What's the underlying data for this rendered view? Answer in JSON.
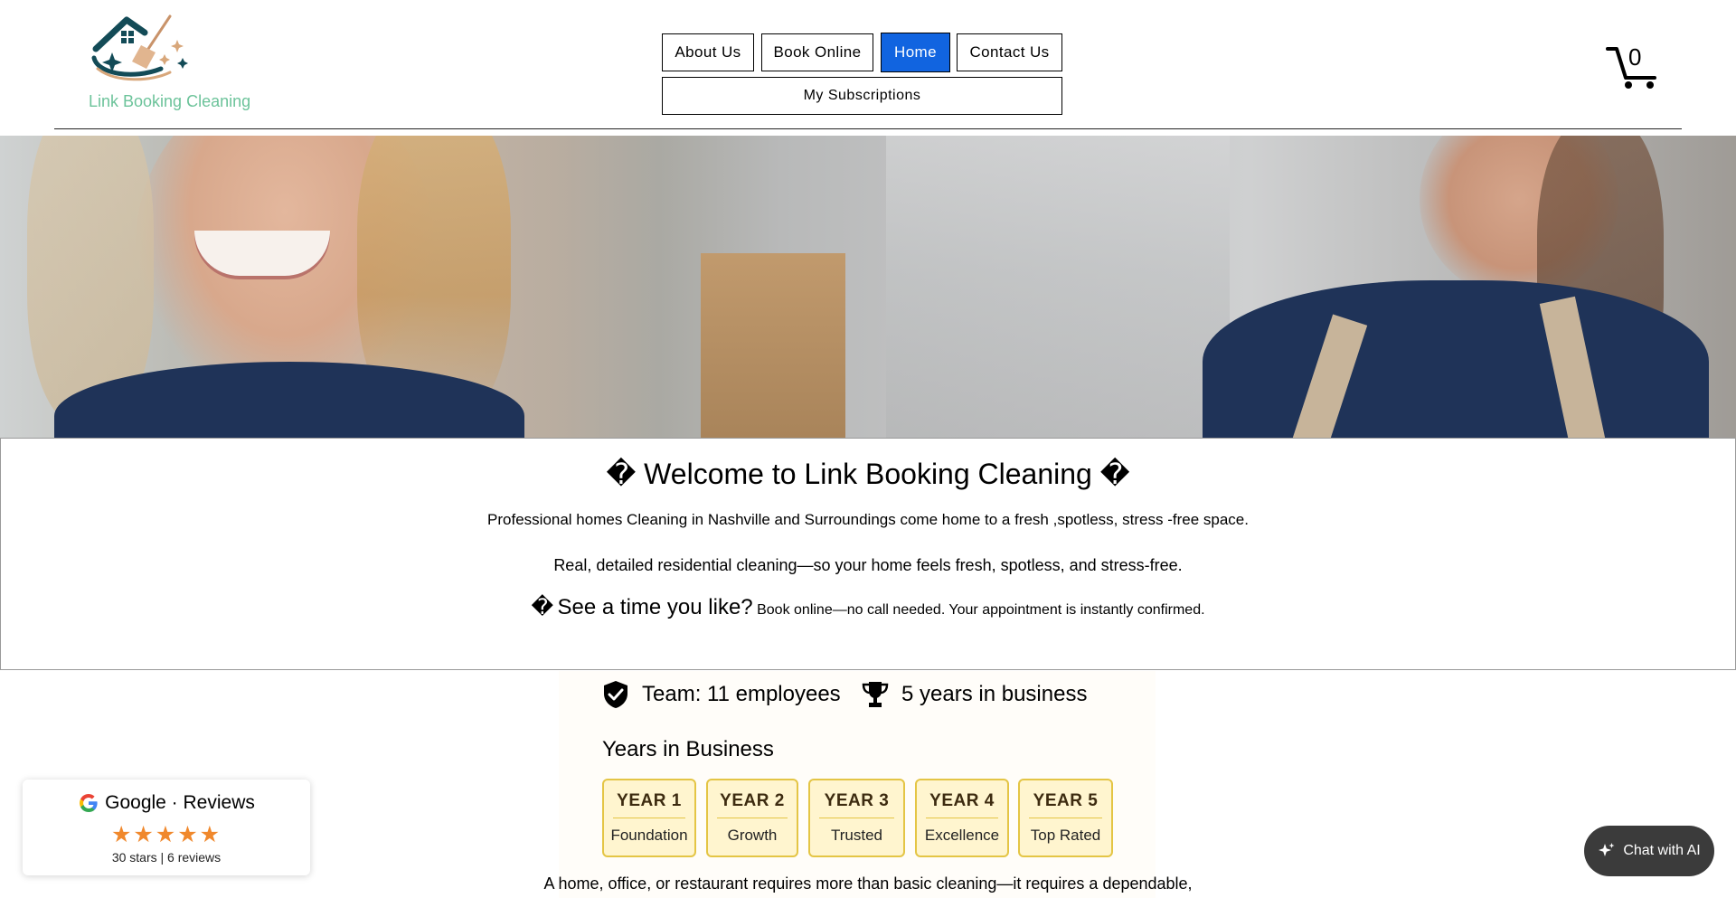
{
  "header": {
    "brand": "Link Booking Cleaning",
    "nav": [
      {
        "label": "About Us",
        "active": false
      },
      {
        "label": "Book Online",
        "active": false
      },
      {
        "label": "Home",
        "active": true
      },
      {
        "label": "Contact Us",
        "active": false
      }
    ],
    "subscriptions_label": "My Subscriptions",
    "cart_count": "0"
  },
  "welcome": {
    "title_glyph_left": "�",
    "title": "Welcome to Link Booking Cleaning",
    "title_glyph_right": "�",
    "subtitle": "Professional homes Cleaning in Nashville and Surroundings come home to a fresh ,spotless, stress -free space.",
    "line2": "Real, detailed residential cleaning—so your home feels fresh, spotless, and stress-free.",
    "cta_glyph": "�",
    "cta_big": "See a time you like?",
    "cta_small": "Book online—no call needed. Your appointment is instantly confirmed."
  },
  "stats": {
    "team": "Team: 11 employees",
    "years": "5 years in business"
  },
  "years_section": {
    "title": "Years in Business",
    "cards": [
      {
        "year": "YEAR 1",
        "label": "Foundation"
      },
      {
        "year": "YEAR 2",
        "label": "Growth"
      },
      {
        "year": "YEAR 3",
        "label": "Trusted"
      },
      {
        "year": "YEAR 4",
        "label": "Excellence"
      },
      {
        "year": "YEAR 5",
        "label": "Top Rated"
      }
    ]
  },
  "bottom_text": "A home, office, or restaurant requires more than basic cleaning—it requires a dependable,",
  "google_widget": {
    "title": "Google · Reviews",
    "stars": "★★★★★",
    "summary": "30 stars | 6 reviews"
  },
  "chat": {
    "label": "Chat with AI"
  },
  "colors": {
    "brand_green": "#6cc39a",
    "nav_active": "#1164e0",
    "star_orange": "#f0882c",
    "card_border": "#e4c545",
    "card_bg": "#fff5cf",
    "chat_bg": "#3b3b3b"
  },
  "icons": {
    "logo": "house-broom-logo",
    "cart": "shopping-cart-icon",
    "team": "shield-check-icon",
    "years": "trophy-icon",
    "google": "google-g-icon",
    "chat": "sparkle-icon"
  }
}
